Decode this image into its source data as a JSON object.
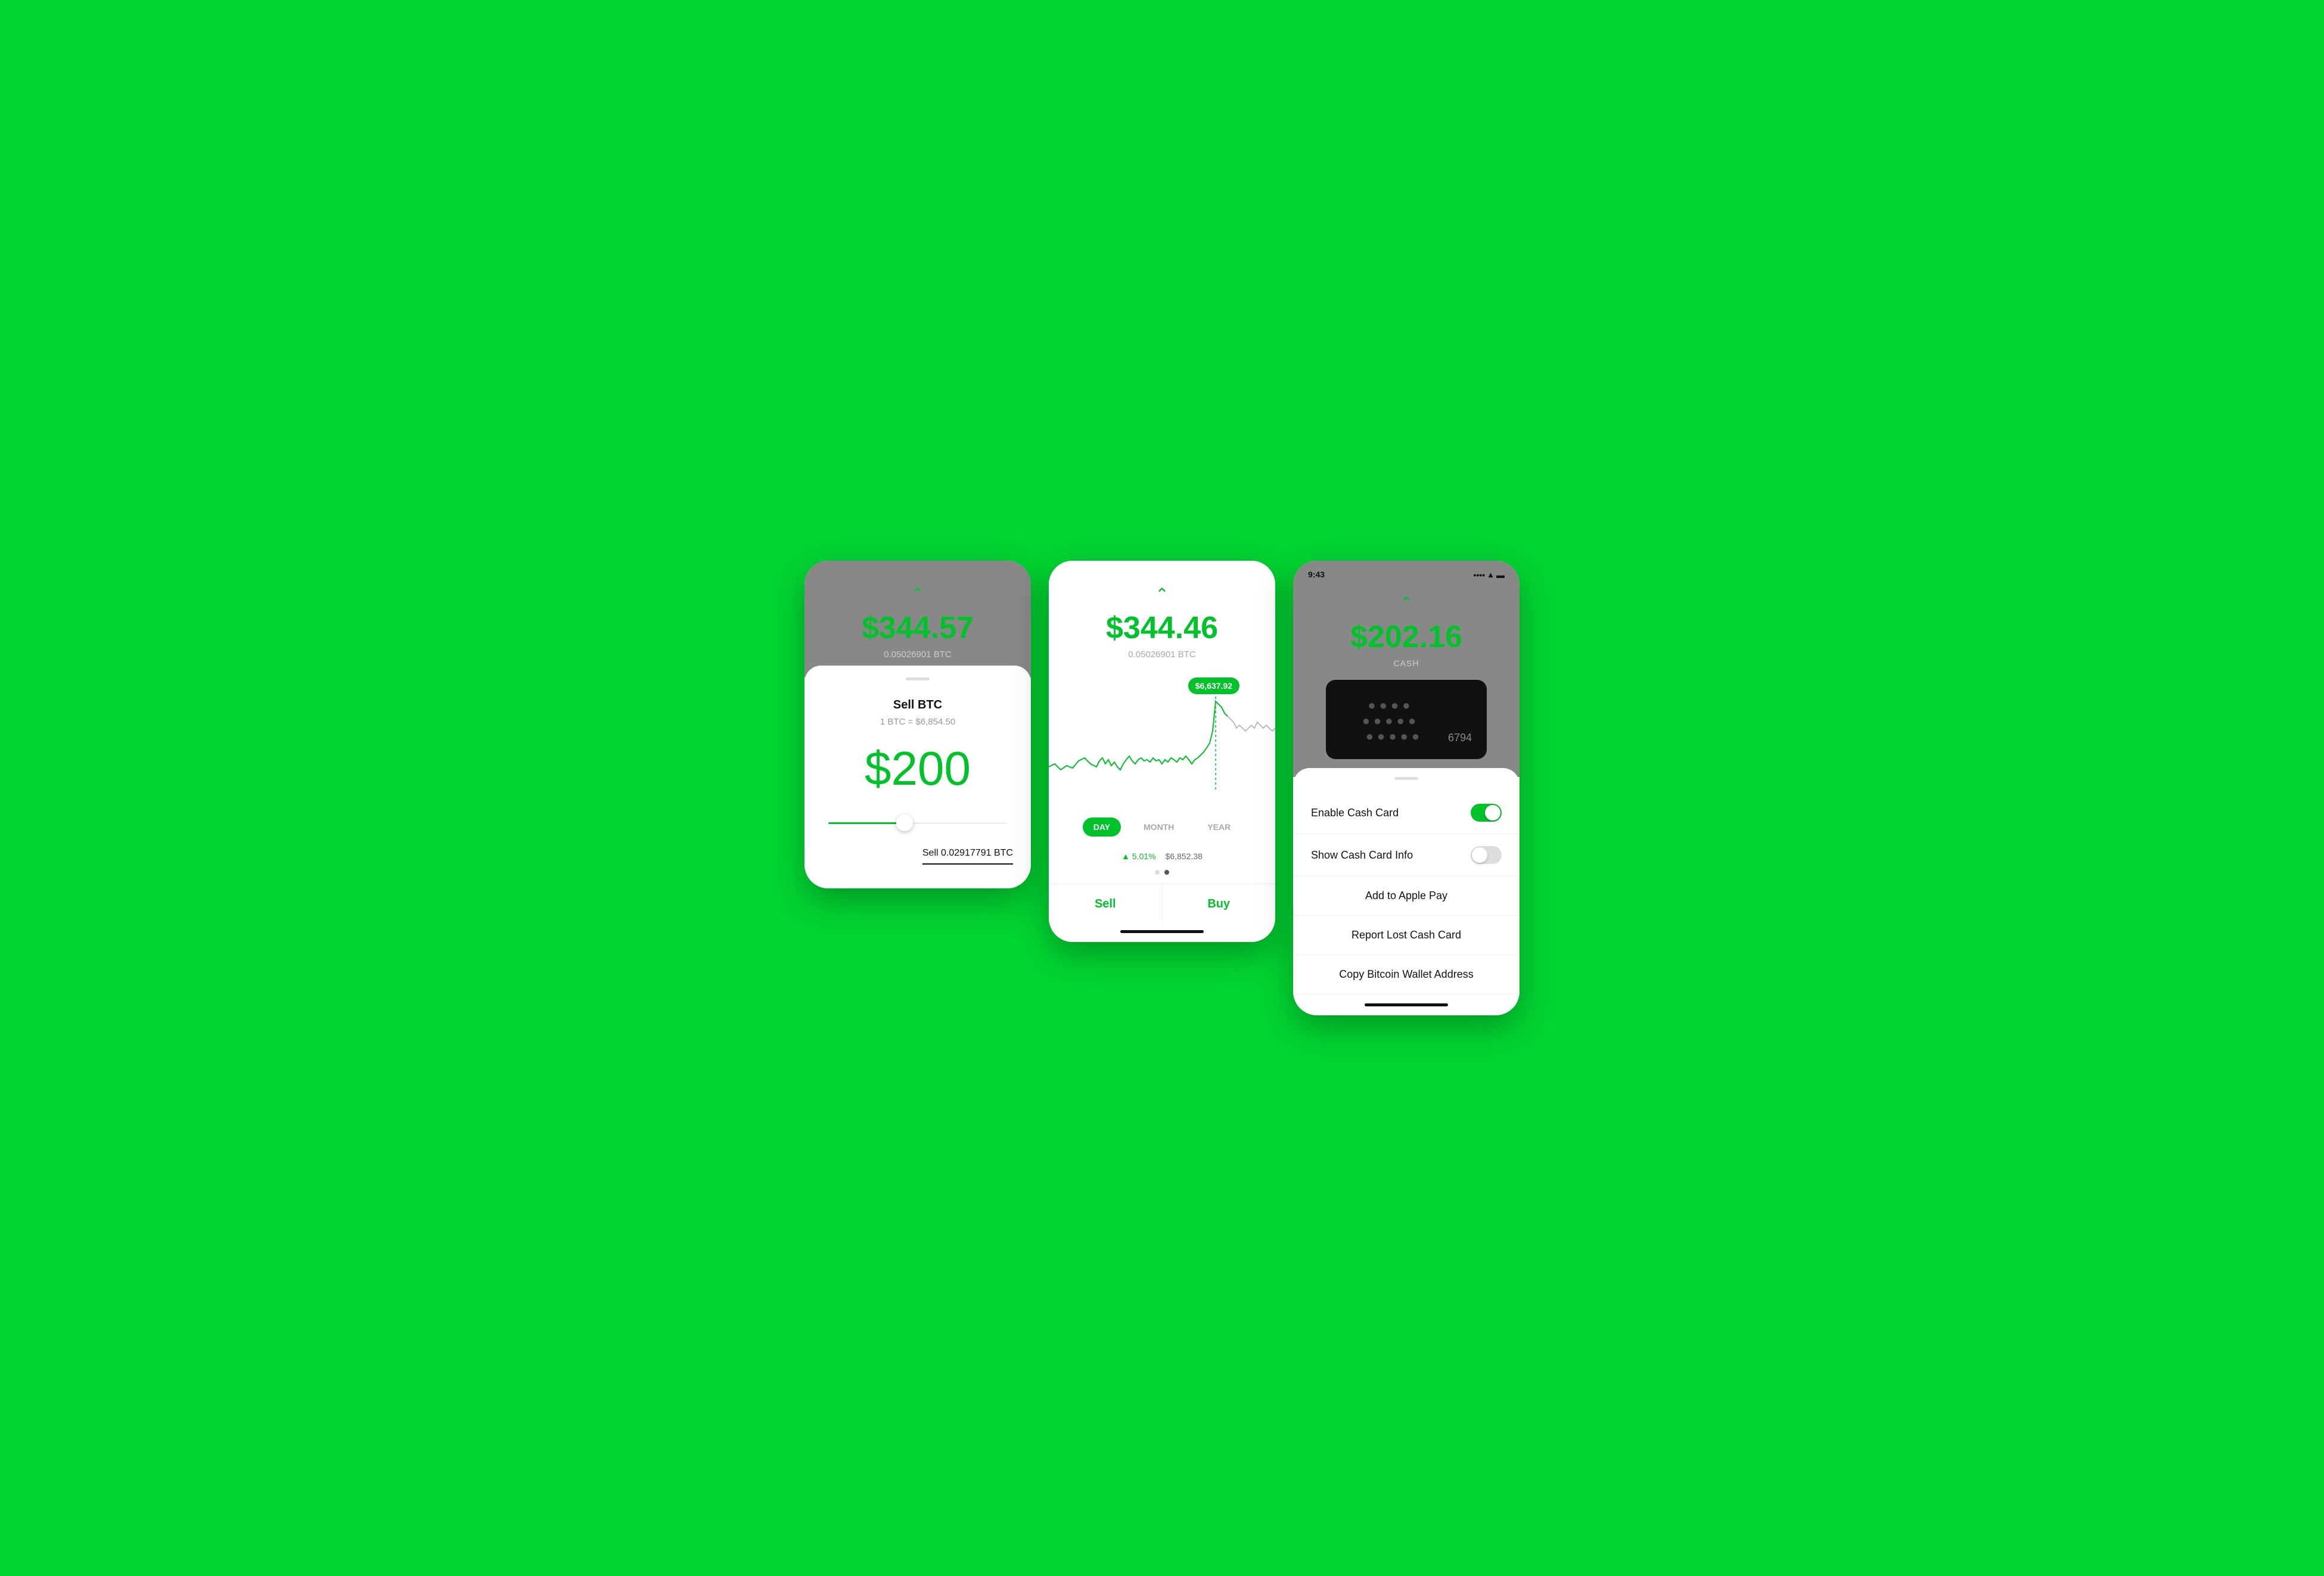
{
  "background_color": "#00D632",
  "screens": {
    "screen1": {
      "btc_price": "$344.57",
      "btc_amount": "0.05026901 BTC",
      "title": "Sell BTC",
      "rate": "1 BTC = $6,854.50",
      "sell_amount": "$200",
      "sell_label": "Sell 0.02917791 BTC"
    },
    "screen2": {
      "btc_price": "$344.46",
      "btc_amount": "0.05026901 BTC",
      "tooltip_price": "$6,637.92",
      "time_options": [
        "DAY",
        "MONTH",
        "YEAR"
      ],
      "active_time": "DAY",
      "stat_percent": "5.01%",
      "stat_price": "$6,852.38",
      "sell_label": "Sell",
      "buy_label": "Buy"
    },
    "screen3": {
      "status_bar": {
        "time": "9:43",
        "signal": "signal",
        "wifi": "wifi",
        "battery": "battery"
      },
      "cash_amount": "$202.16",
      "cash_label": "CASH",
      "card_last4": "6794",
      "menu_items": [
        {
          "label": "Enable Cash Card",
          "type": "toggle",
          "state": "on"
        },
        {
          "label": "Show Cash Card Info",
          "type": "toggle",
          "state": "off"
        }
      ],
      "action_items": [
        "Add to Apple Pay",
        "Report Lost Cash Card",
        "Copy Bitcoin Wallet Address"
      ]
    }
  }
}
